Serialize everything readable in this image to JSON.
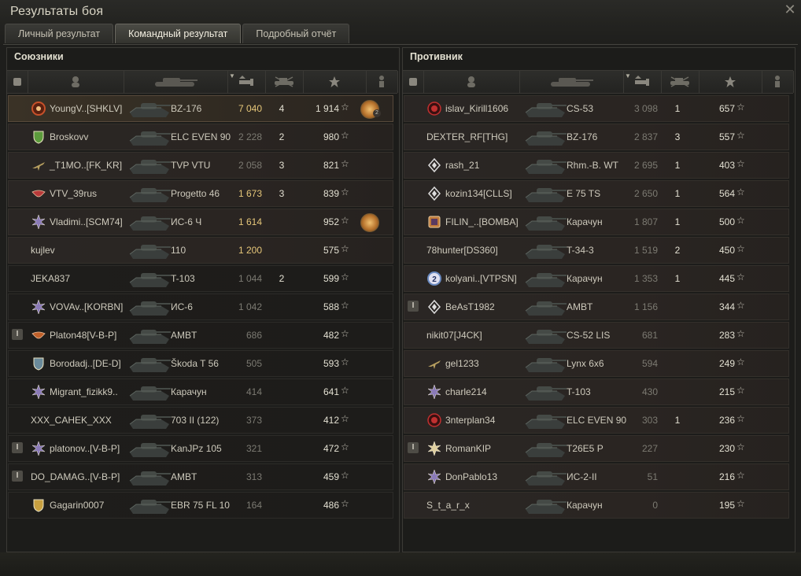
{
  "window": {
    "title": "Результаты боя",
    "close_glyph": "✕"
  },
  "tabs": [
    {
      "label": "Личный результат",
      "active": false
    },
    {
      "label": "Командный результат",
      "active": true
    },
    {
      "label": "Подробный отчёт",
      "active": false
    }
  ],
  "teams": {
    "allies": {
      "title": "Союзники",
      "rows": [
        {
          "platoon": false,
          "clan_icon": "red-emblem-icon",
          "clan_color": "#c7512a",
          "player": "YoungV..[SHKLV]",
          "tank": "BZ-176",
          "damage": "7 040",
          "frags": "4",
          "xp": "1 914",
          "achievement": true,
          "achievement_count": "2",
          "highlight": "me",
          "damage_level": "hi"
        },
        {
          "platoon": false,
          "clan_icon": "green-shield-icon",
          "clan_color": "#5c9b3c",
          "player": "Broskovv",
          "tank": "ELC EVEN 90",
          "damage": "2 228",
          "frags": "2",
          "xp": "980",
          "achievement": false,
          "damage_level": "lo"
        },
        {
          "platoon": false,
          "clan_icon": "aircraft-icon",
          "clan_color": "#b8a060",
          "player": "_T1MO..[FK_KR]",
          "tank": "TVP VTU",
          "damage": "2 058",
          "frags": "3",
          "xp": "821",
          "achievement": false,
          "damage_level": "lo"
        },
        {
          "platoon": false,
          "clan_icon": "red-wing-icon",
          "clan_color": "#b83a3a",
          "player": "VTV_39rus",
          "tank": "Progetto 46",
          "damage": "1 673",
          "frags": "3",
          "xp": "839",
          "achievement": false,
          "damage_level": "hi"
        },
        {
          "platoon": false,
          "clan_icon": "star-badge-icon",
          "clan_color": "#8a7ab8",
          "player": "Vladimi..[SCM74]",
          "tank": "ИС-6 Ч",
          "damage": "1 614",
          "frags": "",
          "xp": "952",
          "achievement": true,
          "achievement_count": "",
          "damage_level": "hi"
        },
        {
          "platoon": false,
          "clan_icon": "",
          "player": "kujlev",
          "tank": "110",
          "damage": "1 200",
          "frags": "",
          "xp": "575",
          "achievement": false,
          "damage_level": "hi"
        },
        {
          "platoon": false,
          "clan_icon": "",
          "player": "JEKA837",
          "tank": "T-103",
          "damage": "1 044",
          "frags": "2",
          "xp": "599",
          "achievement": false,
          "damage_level": "lo",
          "dead": true
        },
        {
          "platoon": false,
          "clan_icon": "star-badge-icon",
          "clan_color": "#8a7ab8",
          "player": "VOVAv..[KORBN]",
          "tank": "ИС-6",
          "damage": "1 042",
          "frags": "",
          "xp": "588",
          "achievement": false,
          "damage_level": "lo",
          "dead": true
        },
        {
          "platoon": true,
          "platoon_label": "I",
          "clan_icon": "red-wing-icon",
          "clan_color": "#c0602a",
          "player": "Platon48[V-B-P]",
          "tank": "AMBT",
          "damage": "686",
          "frags": "",
          "xp": "482",
          "achievement": false,
          "damage_level": "lo",
          "dead": true
        },
        {
          "platoon": false,
          "clan_icon": "green-shield-icon",
          "clan_color": "#6a8a9a",
          "player": "Borodadj..[DE-D]",
          "tank": "Škoda T 56",
          "damage": "505",
          "frags": "",
          "xp": "593",
          "achievement": false,
          "damage_level": "lo",
          "dead": true
        },
        {
          "platoon": false,
          "clan_icon": "star-badge-icon",
          "clan_color": "#8a7ab8",
          "player": "Migrant_fizikk9..",
          "tank": "Карачун",
          "damage": "414",
          "frags": "",
          "xp": "641",
          "achievement": false,
          "damage_level": "lo",
          "dead": true
        },
        {
          "platoon": false,
          "clan_icon": "",
          "player": "XXX_CAHEK_XXX",
          "tank": "703 II (122)",
          "damage": "373",
          "frags": "",
          "xp": "412",
          "achievement": false,
          "damage_level": "lo",
          "dead": true
        },
        {
          "platoon": true,
          "platoon_label": "I",
          "clan_icon": "star-badge-icon",
          "clan_color": "#8a7ab8",
          "player": "platonov..[V-B-P]",
          "tank": "KanJPz 105",
          "damage": "321",
          "frags": "",
          "xp": "472",
          "achievement": false,
          "damage_level": "lo",
          "dead": true
        },
        {
          "platoon": true,
          "platoon_label": "I",
          "clan_icon": "",
          "player": "DO_DAMAG..[V-B-P]",
          "tank": "AMBT",
          "damage": "313",
          "frags": "",
          "xp": "459",
          "achievement": false,
          "damage_level": "lo",
          "dead": true
        },
        {
          "platoon": false,
          "clan_icon": "gold-shield-icon",
          "clan_color": "#c8a040",
          "player": "Gagarin0007",
          "tank": "EBR 75 FL 10",
          "damage": "164",
          "frags": "",
          "xp": "486",
          "achievement": false,
          "damage_level": "lo",
          "dead": true
        }
      ]
    },
    "enemies": {
      "title": "Противник",
      "rows": [
        {
          "platoon": false,
          "clan_icon": "red-eye-icon",
          "clan_color": "#c03030",
          "player": "islav_Kirill1606",
          "tank": "CS-53",
          "damage": "3 098",
          "frags": "1",
          "xp": "657",
          "achievement": false,
          "damage_level": "lo"
        },
        {
          "platoon": false,
          "clan_icon": "",
          "player": "DEXTER_RF[THG]",
          "tank": "BZ-176",
          "damage": "2 837",
          "frags": "3",
          "xp": "557",
          "achievement": false,
          "damage_level": "lo"
        },
        {
          "platoon": false,
          "clan_icon": "diamond-icon",
          "clan_color": "#dddddd",
          "player": "rash_21",
          "tank": "Rhm.-B. WT",
          "damage": "2 695",
          "frags": "1",
          "xp": "403",
          "achievement": false,
          "damage_level": "lo"
        },
        {
          "platoon": false,
          "clan_icon": "diamond-icon",
          "clan_color": "#dddddd",
          "player": "kozin134[CLLS]",
          "tank": "E 75 TS",
          "damage": "2 650",
          "frags": "1",
          "xp": "564",
          "achievement": false,
          "damage_level": "lo"
        },
        {
          "platoon": false,
          "clan_icon": "book-icon",
          "clan_color": "#c07a3a",
          "player": "FILIN_..[BOMBA]",
          "tank": "Карачун",
          "damage": "1 807",
          "frags": "1",
          "xp": "500",
          "achievement": false,
          "damage_level": "lo"
        },
        {
          "platoon": false,
          "clan_icon": "",
          "player": "78hunter[DS360]",
          "tank": "T-34-3",
          "damage": "1 519",
          "frags": "2",
          "xp": "450",
          "achievement": false,
          "damage_level": "lo"
        },
        {
          "platoon": false,
          "clan_icon": "number-badge-icon",
          "clan_color": "#6a8ac0",
          "player": "kolyani..[VTPSN]",
          "tank": "Карачун",
          "damage": "1 353",
          "frags": "1",
          "xp": "445",
          "achievement": false,
          "damage_level": "lo"
        },
        {
          "platoon": true,
          "platoon_label": "I",
          "clan_icon": "diamond-icon",
          "clan_color": "#dddddd",
          "player": "BeAsT1982",
          "tank": "AMBT",
          "damage": "1 156",
          "frags": "",
          "xp": "344",
          "achievement": false,
          "damage_level": "lo"
        },
        {
          "platoon": false,
          "clan_icon": "",
          "player": "nikit07[J4CK]",
          "tank": "CS-52 LIS",
          "damage": "681",
          "frags": "",
          "xp": "283",
          "achievement": false,
          "damage_level": "lo"
        },
        {
          "platoon": false,
          "clan_icon": "aircraft-icon",
          "clan_color": "#b8a060",
          "player": "gel1233",
          "tank": "Lynx 6x6",
          "damage": "594",
          "frags": "",
          "xp": "249",
          "achievement": false,
          "damage_level": "lo"
        },
        {
          "platoon": false,
          "clan_icon": "star-badge-icon",
          "clan_color": "#8a7ab8",
          "player": "charle214",
          "tank": "T-103",
          "damage": "430",
          "frags": "",
          "xp": "215",
          "achievement": false,
          "damage_level": "lo"
        },
        {
          "platoon": false,
          "clan_icon": "red-eye-icon",
          "clan_color": "#c03030",
          "player": "3nterplan34",
          "tank": "ELC EVEN 90",
          "damage": "303",
          "frags": "1",
          "xp": "236",
          "achievement": false,
          "damage_level": "lo"
        },
        {
          "platoon": true,
          "platoon_label": "I",
          "clan_icon": "star-burst-icon",
          "clan_color": "#e0d0a0",
          "player": "RomanKIP",
          "tank": "T26E5 P",
          "damage": "227",
          "frags": "",
          "xp": "230",
          "achievement": false,
          "damage_level": "lo"
        },
        {
          "platoon": false,
          "clan_icon": "star-badge-icon",
          "clan_color": "#8a7ab8",
          "player": "DonPablo13",
          "tank": "ИС-2-II",
          "damage": "51",
          "frags": "",
          "xp": "216",
          "achievement": false,
          "damage_level": "lo"
        },
        {
          "platoon": false,
          "clan_icon": "",
          "player": "S_t_a_r_x",
          "tank": "Карачун",
          "damage": "0",
          "frags": "",
          "xp": "195",
          "achievement": false,
          "damage_level": "lo"
        }
      ]
    }
  },
  "header_icons": [
    "platoon-icon",
    "player-icon",
    "tank-icon",
    "damage-icon",
    "frags-icon",
    "xp-icon",
    "achievement-icon"
  ],
  "star_glyph": "☆"
}
